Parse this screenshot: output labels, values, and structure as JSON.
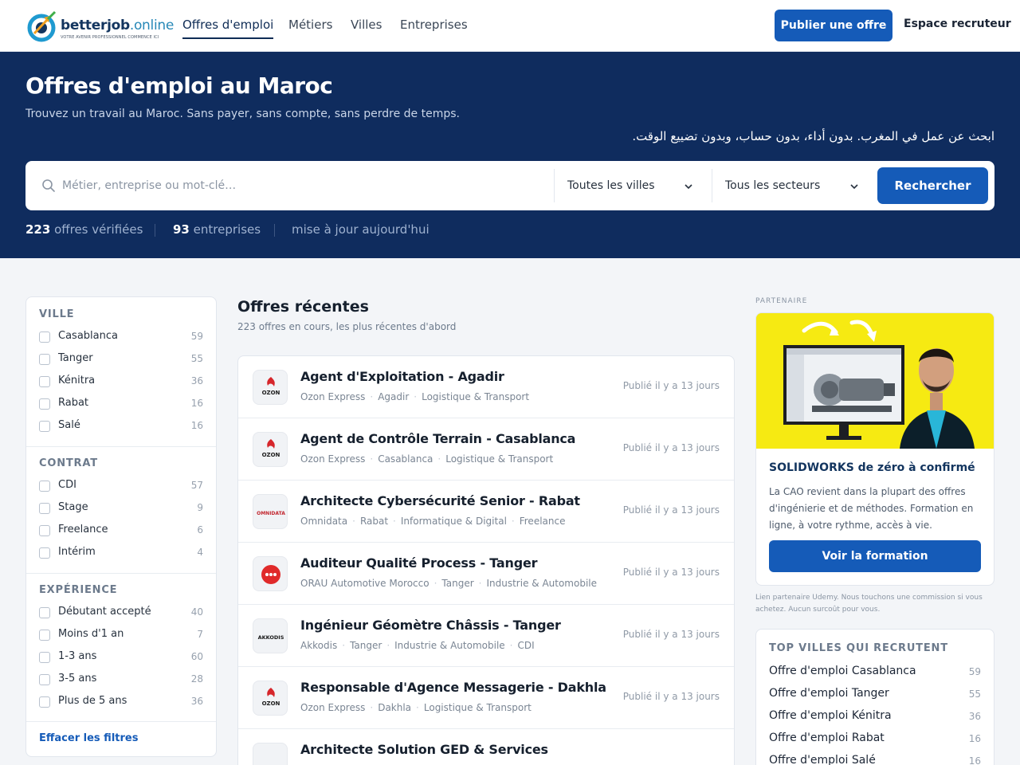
{
  "header": {
    "logo_name": "betterjob",
    "logo_tld": ".online",
    "logo_tagline": "VOTRE AVENIR PROFESSIONNEL COMMENCE ICI",
    "nav": [
      {
        "label": "Offres d'emploi",
        "active": true
      },
      {
        "label": "Métiers",
        "active": false
      },
      {
        "label": "Villes",
        "active": false
      },
      {
        "label": "Entreprises",
        "active": false
      }
    ],
    "publish_label": "Publier une offre",
    "recruiter_label": "Espace recruteur"
  },
  "hero": {
    "title": "Offres d'emploi au Maroc",
    "subtitle": "Trouvez un travail au Maroc. Sans payer, sans compte, sans perdre de temps.",
    "subtitle_ar": "ابحث عن عمل في المغرب. بدون أداء، بدون حساب، وبدون تضييع الوقت.",
    "search_placeholder": "Métier, entreprise ou mot-clé…",
    "city_select": "Toutes les villes",
    "sector_select": "Tous les secteurs",
    "search_button": "Rechercher",
    "stats": {
      "offers_count": "223",
      "offers_label": "offres vérifiées",
      "companies_count": "93",
      "companies_label": "entreprises",
      "updated": "mise à jour aujourd'hui"
    }
  },
  "filters": {
    "sections": [
      {
        "title": "VILLE",
        "items": [
          {
            "label": "Casablanca",
            "count": "59"
          },
          {
            "label": "Tanger",
            "count": "55"
          },
          {
            "label": "Kénitra",
            "count": "36"
          },
          {
            "label": "Rabat",
            "count": "16"
          },
          {
            "label": "Salé",
            "count": "16"
          }
        ]
      },
      {
        "title": "CONTRAT",
        "items": [
          {
            "label": "CDI",
            "count": "57"
          },
          {
            "label": "Stage",
            "count": "9"
          },
          {
            "label": "Freelance",
            "count": "6"
          },
          {
            "label": "Intérim",
            "count": "4"
          }
        ]
      },
      {
        "title": "EXPÉRIENCE",
        "items": [
          {
            "label": "Débutant accepté",
            "count": "40"
          },
          {
            "label": "Moins d'1 an",
            "count": "7"
          },
          {
            "label": "1-3 ans",
            "count": "60"
          },
          {
            "label": "3-5 ans",
            "count": "28"
          },
          {
            "label": "Plus de 5 ans",
            "count": "36"
          }
        ]
      }
    ],
    "clear_label": "Effacer les filtres"
  },
  "main": {
    "title": "Offres récentes",
    "subtitle": "223 offres en cours, les plus récentes d'abord",
    "jobs": [
      {
        "title": "Agent d'Exploitation - Agadir",
        "meta": [
          "Ozon Express",
          "Agadir",
          "Logistique & Transport"
        ],
        "date": "Publié il y a 13 jours",
        "logo": "ozon"
      },
      {
        "title": "Agent de Contrôle Terrain - Casablanca",
        "meta": [
          "Ozon Express",
          "Casablanca",
          "Logistique & Transport"
        ],
        "date": "Publié il y a 13 jours",
        "logo": "ozon"
      },
      {
        "title": "Architecte Cybersécurité Senior - Rabat",
        "meta": [
          "Omnidata",
          "Rabat",
          "Informatique & Digital",
          "Freelance"
        ],
        "date": "Publié il y a 13 jours",
        "logo": "omnidata"
      },
      {
        "title": "Auditeur Qualité Process - Tanger",
        "meta": [
          "ORAU Automotive Morocco",
          "Tanger",
          "Industrie & Automobile"
        ],
        "date": "Publié il y a 13 jours",
        "logo": "orau"
      },
      {
        "title": "Ingénieur Géomètre Châssis - Tanger",
        "meta": [
          "Akkodis",
          "Tanger",
          "Industrie & Automobile",
          "CDI"
        ],
        "date": "Publié il y a 13 jours",
        "logo": "akkodis"
      },
      {
        "title": "Responsable d'Agence Messagerie - Dakhla",
        "meta": [
          "Ozon Express",
          "Dakhla",
          "Logistique & Transport"
        ],
        "date": "Publié il y a 13 jours",
        "logo": "ozon"
      },
      {
        "title": "Architecte Solution GED & Services",
        "meta": [],
        "date": "",
        "logo": ""
      }
    ],
    "logo_texts": {
      "ozon": "OZON",
      "omnidata": "OMNIDATA",
      "akkodis": "AKKODIS"
    }
  },
  "sidebar_right": {
    "partner_label": "PARTENAIRE",
    "promo_title": "SOLIDWORKS de zéro à confirmé",
    "promo_text": "La CAO revient dans la plupart des offres d'ingénierie et de méthodes. Formation en ligne, à votre rythme, accès à vie.",
    "promo_button": "Voir la formation",
    "promo_note": "Lien partenaire Udemy. Nous touchons une commission si vous achetez. Aucun surcoût pour vous.",
    "cities_title": "TOP VILLES QUI RECRUTENT",
    "cities": [
      {
        "label": "Offre d'emploi Casablanca",
        "count": "59"
      },
      {
        "label": "Offre d'emploi Tanger",
        "count": "55"
      },
      {
        "label": "Offre d'emploi Kénitra",
        "count": "36"
      },
      {
        "label": "Offre d'emploi Rabat",
        "count": "16"
      },
      {
        "label": "Offre d'emploi Salé",
        "count": "16"
      }
    ]
  },
  "colors": {
    "navy": "#0f2c5e",
    "primary": "#155bb8",
    "promo_yellow": "#f6ea12"
  }
}
